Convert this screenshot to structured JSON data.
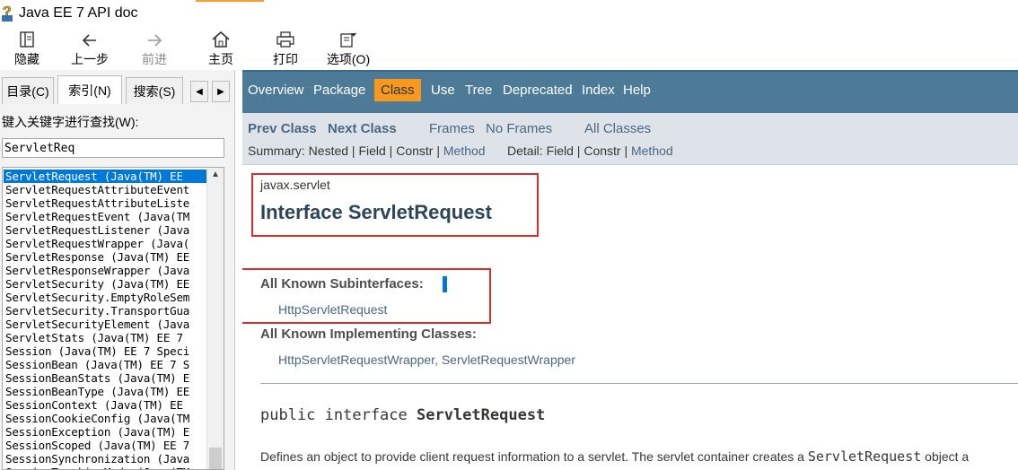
{
  "window": {
    "title": "Java EE 7 API doc"
  },
  "toolbar": {
    "hide": "隐藏",
    "back": "上一步",
    "forward": "前进",
    "home": "主页",
    "print": "打印",
    "options": "选项(O)"
  },
  "left": {
    "tabs": [
      "目录(C)",
      "索引(N)",
      "搜索(S)"
    ],
    "active_tab": "索引(N)",
    "keyword_label": "键入关键字进行查找(W):",
    "keyword_value": "ServletReq",
    "results": [
      "ServletRequest (Java(TM) EE",
      "ServletRequestAttributeEvent",
      "ServletRequestAttributeListe",
      "ServletRequestEvent (Java(TM",
      "ServletRequestListener (Java",
      "ServletRequestWrapper (Java(",
      "ServletResponse (Java(TM) EE",
      "ServletResponseWrapper (Java",
      "ServletSecurity (Java(TM) EE",
      "ServletSecurity.EmptyRoleSem",
      "ServletSecurity.TransportGua",
      "ServletSecurityElement (Java",
      "ServletStats (Java(TM) EE 7",
      "Session (Java(TM) EE 7 Speci",
      "SessionBean (Java(TM) EE 7 S",
      "SessionBeanStats (Java(TM) E",
      "SessionBeanType (Java(TM) EE",
      "SessionContext (Java(TM) EE",
      "SessionCookieConfig (Java(TM",
      "SessionException (Java(TM) E",
      "SessionScoped (Java(TM) EE 7",
      "SessionSynchronization (Java",
      "SessionTrackingMode (Java(TM"
    ],
    "selected_index": 0
  },
  "doc": {
    "topnav": [
      "Overview",
      "Package",
      "Class",
      "Use",
      "Tree",
      "Deprecated",
      "Index",
      "Help"
    ],
    "topnav_active": "Class",
    "prev_class": "Prev Class",
    "next_class": "Next Class",
    "frames": "Frames",
    "no_frames": "No Frames",
    "all_classes": "All Classes",
    "summary_prefix": "Summary: Nested | Field | Constr | ",
    "summary_method": "Method",
    "detail_prefix": "Detail: Field | Constr | ",
    "detail_method": "Method",
    "package": "javax.servlet",
    "title": "Interface ServletRequest",
    "subinterfaces_label": "All Known Subinterfaces:",
    "subinterfaces": "HttpServletRequest",
    "implementing_label": "All Known Implementing Classes:",
    "implementing_1": "HttpServletRequestWrapper",
    "implementing_sep": ", ",
    "implementing_2": "ServletRequestWrapper",
    "decl_prefix": "public interface ",
    "decl_name": "ServletRequest",
    "desc_text": "Defines an object to provide client request information to a servlet. The servlet container creates a ",
    "desc_code": "ServletRequest",
    "desc_tail": " object a"
  },
  "colors": {
    "nav_bg": "#4d7a97",
    "nav_active": "#f8981d",
    "subnav_bg": "#dee3e9",
    "link": "#4a6782",
    "highlight_box": "#d32f2f",
    "selection": "#0078d7"
  }
}
